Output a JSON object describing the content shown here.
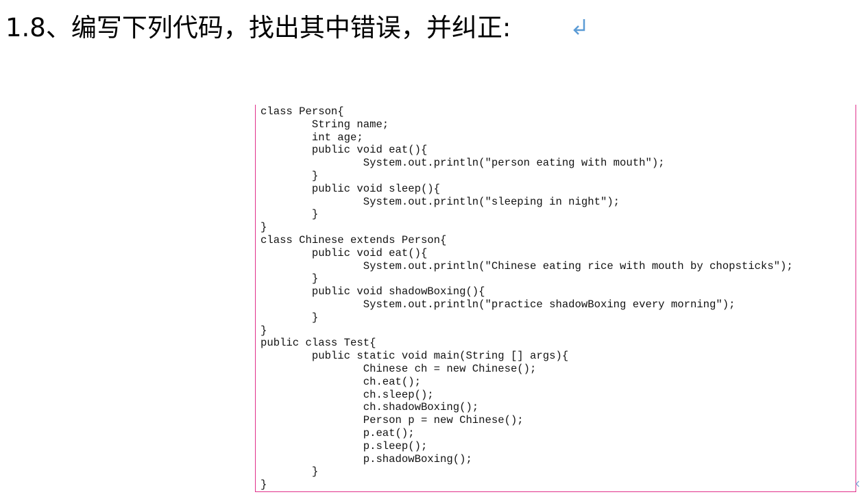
{
  "heading": {
    "text": "1.8、编写下列代码，找出其中错误，并纠正:"
  },
  "code": {
    "lines": [
      "class Person{",
      "        String name;",
      "        int age;",
      "        public void eat(){",
      "                System.out.println(\"person eating with mouth\");",
      "        }",
      "        public void sleep(){",
      "                System.out.println(\"sleeping in night\");",
      "        }",
      "}",
      "class Chinese extends Person{",
      "        public void eat(){",
      "                System.out.println(\"Chinese eating rice with mouth by chopsticks\");",
      "        }",
      "        public void shadowBoxing(){",
      "                System.out.println(\"practice shadowBoxing every morning\");",
      "        }",
      "}",
      "public class Test{",
      "        public static void main(String [] args){",
      "                Chinese ch = new Chinese();",
      "                ch.eat();",
      "                ch.sleep();",
      "                ch.shadowBoxing();",
      "                Person p = new Chinese();",
      "                p.eat();",
      "                p.sleep();",
      "                p.shadowBoxing();",
      "        }",
      "}"
    ]
  },
  "colors": {
    "frame_border": "#e0308a",
    "paragraph_mark": "#5b9bd5",
    "text": "#000000"
  },
  "icons": {
    "paragraph_mark": "return-arrow-icon"
  }
}
